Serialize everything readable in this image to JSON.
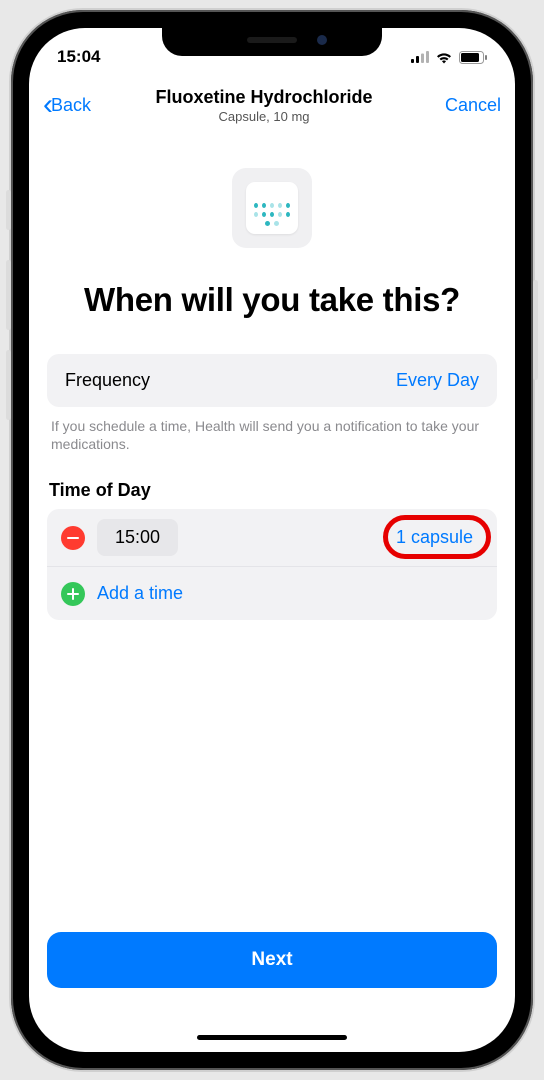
{
  "status": {
    "time": "15:04"
  },
  "nav": {
    "back": "Back",
    "title": "Fluoxetine Hydrochloride",
    "subtitle": "Capsule, 10 mg",
    "cancel": "Cancel"
  },
  "headline": "When will you take this?",
  "frequency": {
    "label": "Frequency",
    "value": "Every Day"
  },
  "hint": "If you schedule a time, Health will send you a notification to take your medications.",
  "time_section": {
    "title": "Time of Day",
    "rows": [
      {
        "time": "15:00",
        "dosage": "1 capsule"
      }
    ],
    "add_label": "Add a time"
  },
  "next": "Next"
}
